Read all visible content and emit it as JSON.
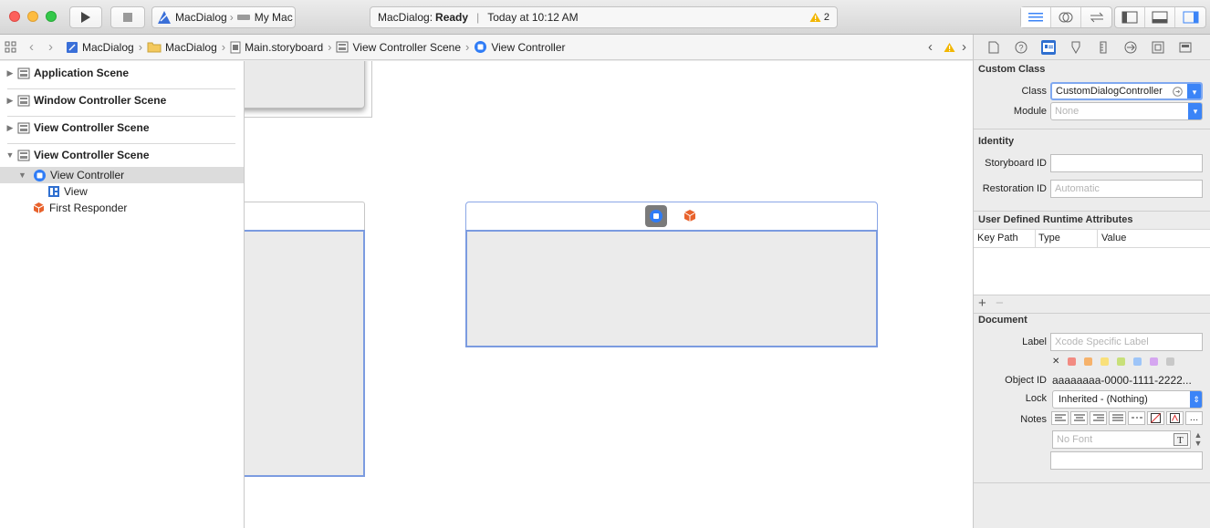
{
  "toolbar": {
    "scheme_target": "MacDialog",
    "scheme_device": "My Mac",
    "status_project": "MacDialog: ",
    "status_state": "Ready",
    "status_time": "Today at 10:12 AM",
    "warning_count": "2"
  },
  "jumpbar": {
    "crumbs": [
      "MacDialog",
      "MacDialog",
      "Main.storyboard",
      "View Controller Scene",
      "View Controller"
    ]
  },
  "navigator": {
    "scenes": [
      "Application Scene",
      "Window Controller Scene",
      "View Controller Scene",
      "View Controller Scene"
    ],
    "tree": [
      "View Controller",
      "View",
      "First Responder"
    ]
  },
  "inspector": {
    "custom_class": {
      "title": "Custom Class",
      "class_label": "Class",
      "class_value": "CustomDialogController",
      "module_label": "Module",
      "module_placeholder": "None"
    },
    "identity": {
      "title": "Identity",
      "storyboard_id_label": "Storyboard ID",
      "storyboard_id_value": "",
      "restoration_id_label": "Restoration ID",
      "restoration_id_placeholder": "Automatic"
    },
    "runtime_attributes": {
      "title": "User Defined Runtime Attributes",
      "columns": [
        "Key Path",
        "Type",
        "Value"
      ],
      "add_label": "+",
      "remove_label": "−"
    },
    "document": {
      "title": "Document",
      "label_label": "Label",
      "label_placeholder": "Xcode Specific Label",
      "clear_glyph": "✕",
      "object_id_label": "Object ID",
      "object_id_value": "aaaaaaaa-0000-1111-2222...",
      "lock_label": "Lock",
      "lock_value": "Inherited - (Nothing)",
      "notes_label": "Notes",
      "font_placeholder": "No Font"
    },
    "label_colors": [
      "#f28b82",
      "#f6b26b",
      "#f9e07a",
      "#c8e07a",
      "#9ec5f8",
      "#d5a6f0",
      "#c8c8c8"
    ]
  },
  "colors": {
    "accent": "#3b84f7",
    "selection": "#dcdcdc",
    "canvas_scene_border": "#7b9be0",
    "warning": "#f2b600",
    "responder": "#e8622c"
  }
}
